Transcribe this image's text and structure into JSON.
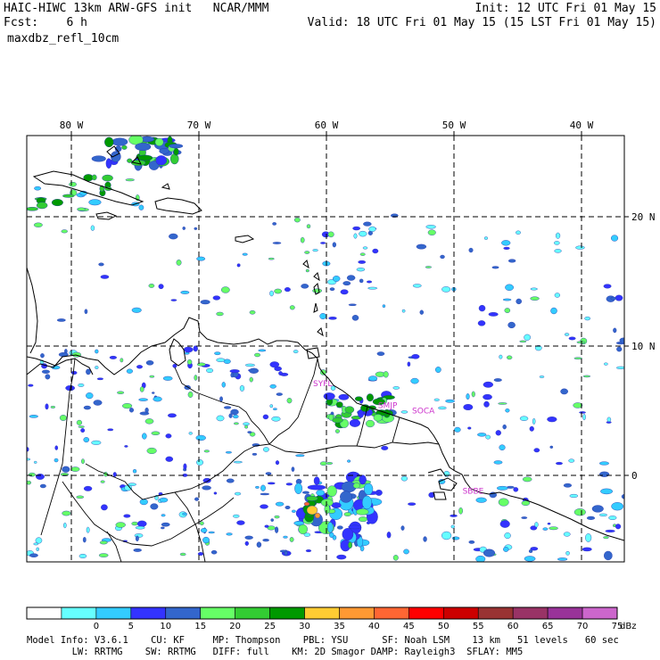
{
  "header": {
    "model": "HAIC-HIWC 13km ARW-GFS init   NCAR/MMM",
    "init": "Init: 12 UTC Fri 01 May 15",
    "fcst": "Fcst:    6 h",
    "valid": "Valid: 18 UTC Fri 01 May 15 (15 LST Fri 01 May 15)",
    "field": "maxdbz_refl_10cm"
  },
  "map": {
    "lon_labels": [
      {
        "lon": -80,
        "text": "80 W"
      },
      {
        "lon": -70,
        "text": "70 W"
      },
      {
        "lon": -60,
        "text": "60 W"
      },
      {
        "lon": -50,
        "text": "50 W"
      },
      {
        "lon": -40,
        "text": "40 W"
      }
    ],
    "lat_labels": [
      {
        "lat": 20,
        "text": "20 N"
      },
      {
        "lat": 10,
        "text": "10 N"
      },
      {
        "lat": 0,
        "text": "0"
      }
    ],
    "stations": [
      {
        "id": "TTPP",
        "lon": -60.3,
        "lat": 6.9,
        "text": "SYFL"
      },
      {
        "id": "SMJP",
        "lon": -55.2,
        "lat": 5.2,
        "text": "SMJP"
      },
      {
        "id": "SOCA",
        "lon": -52.4,
        "lat": 4.8,
        "text": "SOCA"
      },
      {
        "id": "SBBE",
        "lon": -48.5,
        "lat": -1.4,
        "text": "SBBE"
      }
    ],
    "station_color": "#cc33cc"
  },
  "colorbar": {
    "unit": "dBz",
    "ticks": [
      "0",
      "5",
      "10",
      "15",
      "20",
      "25",
      "30",
      "35",
      "40",
      "45",
      "50",
      "55",
      "60",
      "65",
      "70",
      "75"
    ],
    "colors": [
      "#ffffff",
      "#ffffff",
      "#66ffff",
      "#33ccff",
      "#3333ff",
      "#3366cc",
      "#66ff66",
      "#33cc33",
      "#009900",
      "#ffcc33",
      "#ff9933",
      "#ff6633",
      "#ff0000",
      "#cc0000",
      "#993333",
      "#993366",
      "#993399",
      "#cc66cc"
    ]
  },
  "footer": {
    "line1": "Model Info: V3.6.1    CU: KF     MP: Thompson    PBL: YSU      SF: Noah LSM    13 km   51 levels   60 sec",
    "line2": "        LW: RRTMG    SW: RRTMG   DIFF: full    KM: 2D Smagor DAMP: Rayleigh3  SFLAY: MM5"
  }
}
